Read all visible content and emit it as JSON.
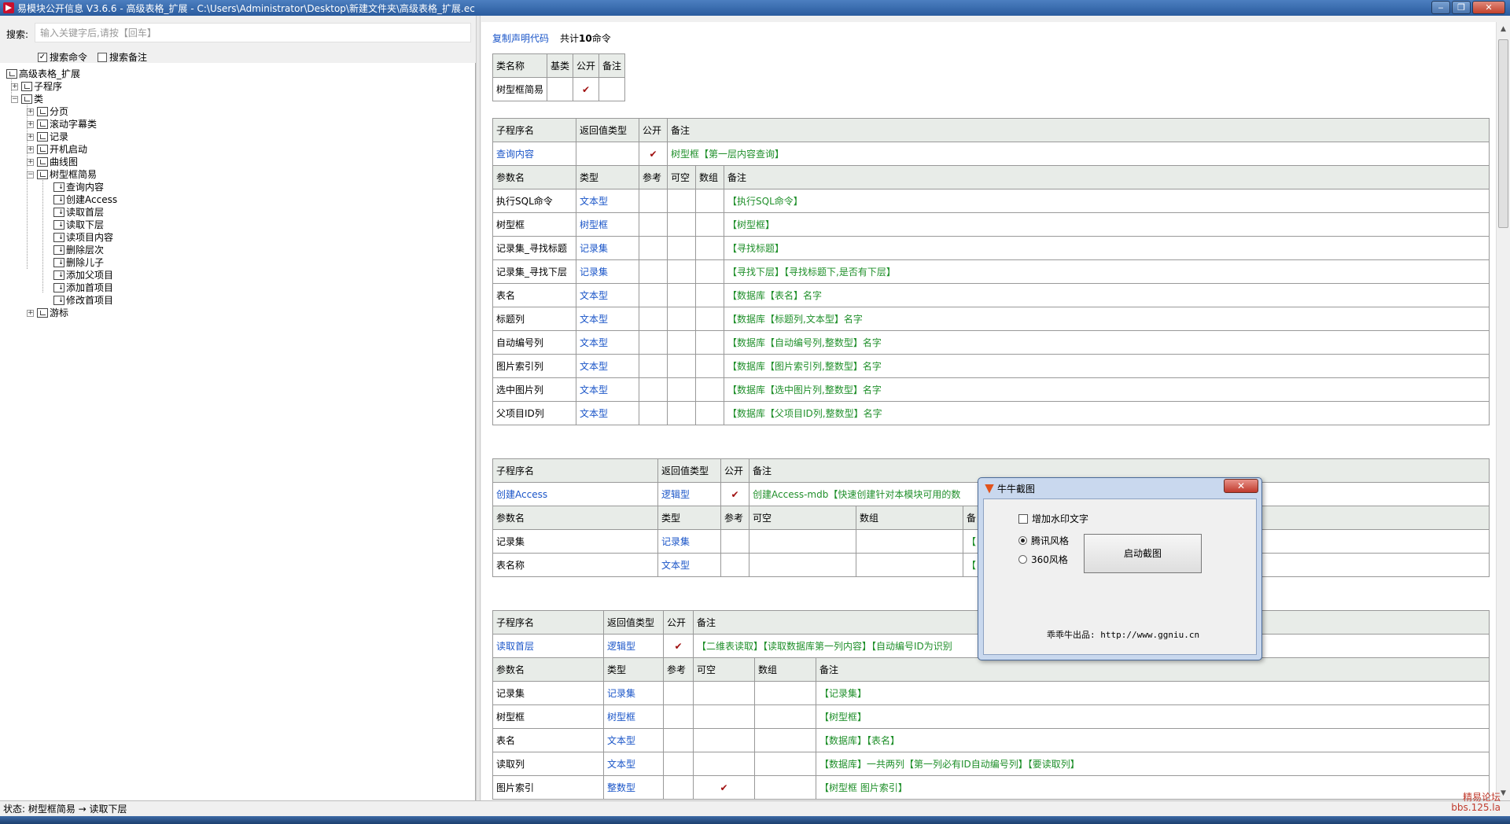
{
  "window": {
    "title": "易模块公开信息 V3.6.6 - 高级表格_扩展 - C:\\Users\\Administrator\\Desktop\\新建文件夹\\高级表格_扩展.ec",
    "min": "‒",
    "max": "❐",
    "close": "✕"
  },
  "search": {
    "label": "搜索:",
    "placeholder": "输入关键字后,请按【回车】",
    "opt_cmd": "搜索命令",
    "opt_note": "搜索备注"
  },
  "tree": {
    "root": "高级表格_扩展",
    "subprog": "子程序",
    "classes": "类",
    "c1": "分页",
    "c2": "滚动字幕类",
    "c3": "记录",
    "c4": "开机启动",
    "c5": "曲线图",
    "c6": "树型框简易",
    "m1": "查询内容",
    "m2": "创建Access",
    "m3": "读取首层",
    "m4": "读取下层",
    "m5": "读项目内容",
    "m6": "删除层次",
    "m7": "删除儿子",
    "m8": "添加父项目",
    "m9": "添加首项目",
    "m10": "修改首项目",
    "c7": "游标"
  },
  "content": {
    "copy_link": "复制声明代码",
    "total_prefix": "共计",
    "total_num": "10",
    "total_suffix": "命令",
    "class_table": {
      "headers": [
        "类名称",
        "基类",
        "公开",
        "备注"
      ],
      "name": "树型框简易",
      "check": "✔"
    },
    "t1": {
      "sub_headers": [
        "子程序名",
        "返回值类型",
        "公开",
        "备注"
      ],
      "name": "查询内容",
      "ret": "",
      "check": "✔",
      "note": "树型框【第一层内容查询】",
      "param_headers": [
        "参数名",
        "类型",
        "参考",
        "可空",
        "数组",
        "备注"
      ],
      "params": [
        {
          "n": "执行SQL命令",
          "t": "文本型",
          "note": "【执行SQL命令】"
        },
        {
          "n": "树型框",
          "t": "树型框",
          "note": "【树型框】"
        },
        {
          "n": "记录集_寻找标题",
          "t": "记录集",
          "note": "【寻找标题】"
        },
        {
          "n": "记录集_寻找下层",
          "t": "记录集",
          "note": "【寻找下层】【寻找标题下,是否有下层】"
        },
        {
          "n": "表名",
          "t": "文本型",
          "note": "【数据库【表名】名字"
        },
        {
          "n": "标题列",
          "t": "文本型",
          "note": "【数据库【标题列,文本型】名字"
        },
        {
          "n": "自动编号列",
          "t": "文本型",
          "note": "【数据库【自动编号列,整数型】名字"
        },
        {
          "n": "图片索引列",
          "t": "文本型",
          "note": "【数据库【图片索引列,整数型】名字"
        },
        {
          "n": "选中图片列",
          "t": "文本型",
          "note": "【数据库【选中图片列,整数型】名字"
        },
        {
          "n": "父项目ID列",
          "t": "文本型",
          "note": "【数据库【父项目ID列,整数型】名字"
        }
      ]
    },
    "t2": {
      "name": "创建Access",
      "ret": "逻辑型",
      "check": "✔",
      "note": "创建Access-mdb【快速创建针对本模块可用的数",
      "param_headers": [
        "参数名",
        "类型",
        "参考",
        "可空",
        "数组",
        "备"
      ],
      "params": [
        {
          "n": "记录集",
          "t": "记录集",
          "note": "【"
        },
        {
          "n": "表名称",
          "t": "文本型",
          "note": "【"
        }
      ]
    },
    "t3": {
      "name": "读取首层",
      "ret": "逻辑型",
      "check": "✔",
      "note": "【二维表读取】【读取数据库第一列内容】【自动编号ID为识别",
      "params": [
        {
          "n": "记录集",
          "t": "记录集",
          "c": "",
          "note": "【记录集】"
        },
        {
          "n": "树型框",
          "t": "树型框",
          "c": "",
          "note": "【树型框】"
        },
        {
          "n": "表名",
          "t": "文本型",
          "c": "",
          "note": "【数据库】【表名】"
        },
        {
          "n": "读取列",
          "t": "文本型",
          "c": "",
          "note": "【数据库】一共两列【第一列必有ID自动编号列】【要读取列】"
        },
        {
          "n": "图片索引",
          "t": "整数型",
          "c": "✔",
          "note": "【树型框 图片索引】"
        }
      ]
    }
  },
  "popup": {
    "title": "牛牛截图",
    "close": "✕",
    "watermark": "增加水印文字",
    "style1": "腾讯风格",
    "style2": "360风格",
    "button": "启动截图",
    "footer": "乖乖牛出品: http://www.ggniu.cn"
  },
  "status": {
    "text": "状态: 树型框简易 → 读取下层"
  },
  "watermark": {
    "line1": "精易论坛",
    "line2": "bbs.125.la"
  },
  "colors": {
    "link": "#1a55c8",
    "note_green": "#1f8f2a",
    "check_red": "#a01010",
    "header_bg": "#e8ece8"
  }
}
